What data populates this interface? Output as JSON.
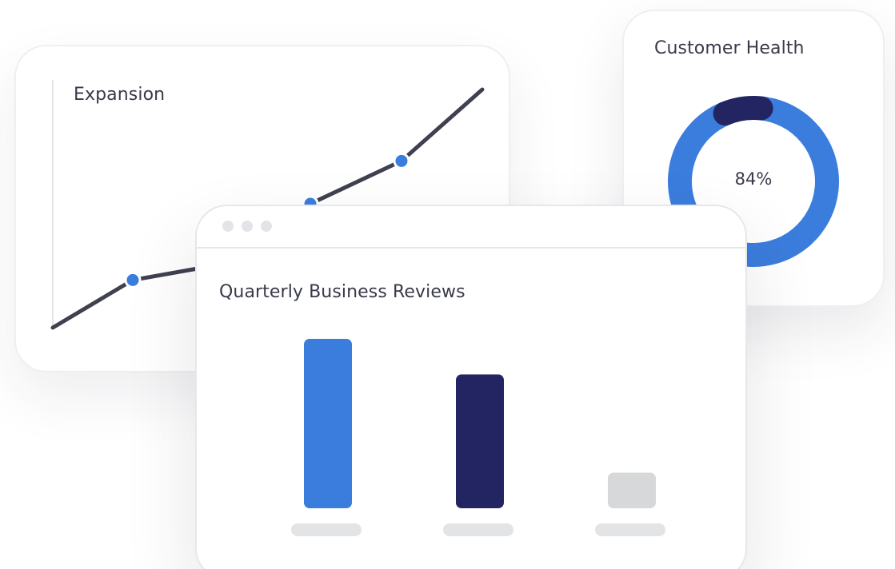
{
  "expansion": {
    "title": "Expansion",
    "chart_data": {
      "type": "line",
      "title": "Expansion",
      "values": [
        0,
        0.2,
        0.25,
        0.52,
        0.7,
        1.0
      ],
      "markers": [
        1,
        3,
        4
      ],
      "colors": {
        "line": "#3f4050",
        "marker": "#3b7ddd"
      }
    }
  },
  "customer_health": {
    "title": "Customer Health",
    "percent_label": "84%",
    "chart_data": {
      "type": "pie",
      "values": [
        0.92,
        0.08
      ],
      "colors": [
        "#3b7ddd",
        "#232563"
      ]
    }
  },
  "qbr": {
    "title": "Quarterly Business Reviews",
    "chart_data": {
      "type": "bar",
      "values": [
        100,
        79,
        21
      ],
      "colors": [
        "#3b7ddd",
        "#232563",
        "#d6d8da"
      ]
    },
    "placeholder_color": "#e3e4e6"
  }
}
